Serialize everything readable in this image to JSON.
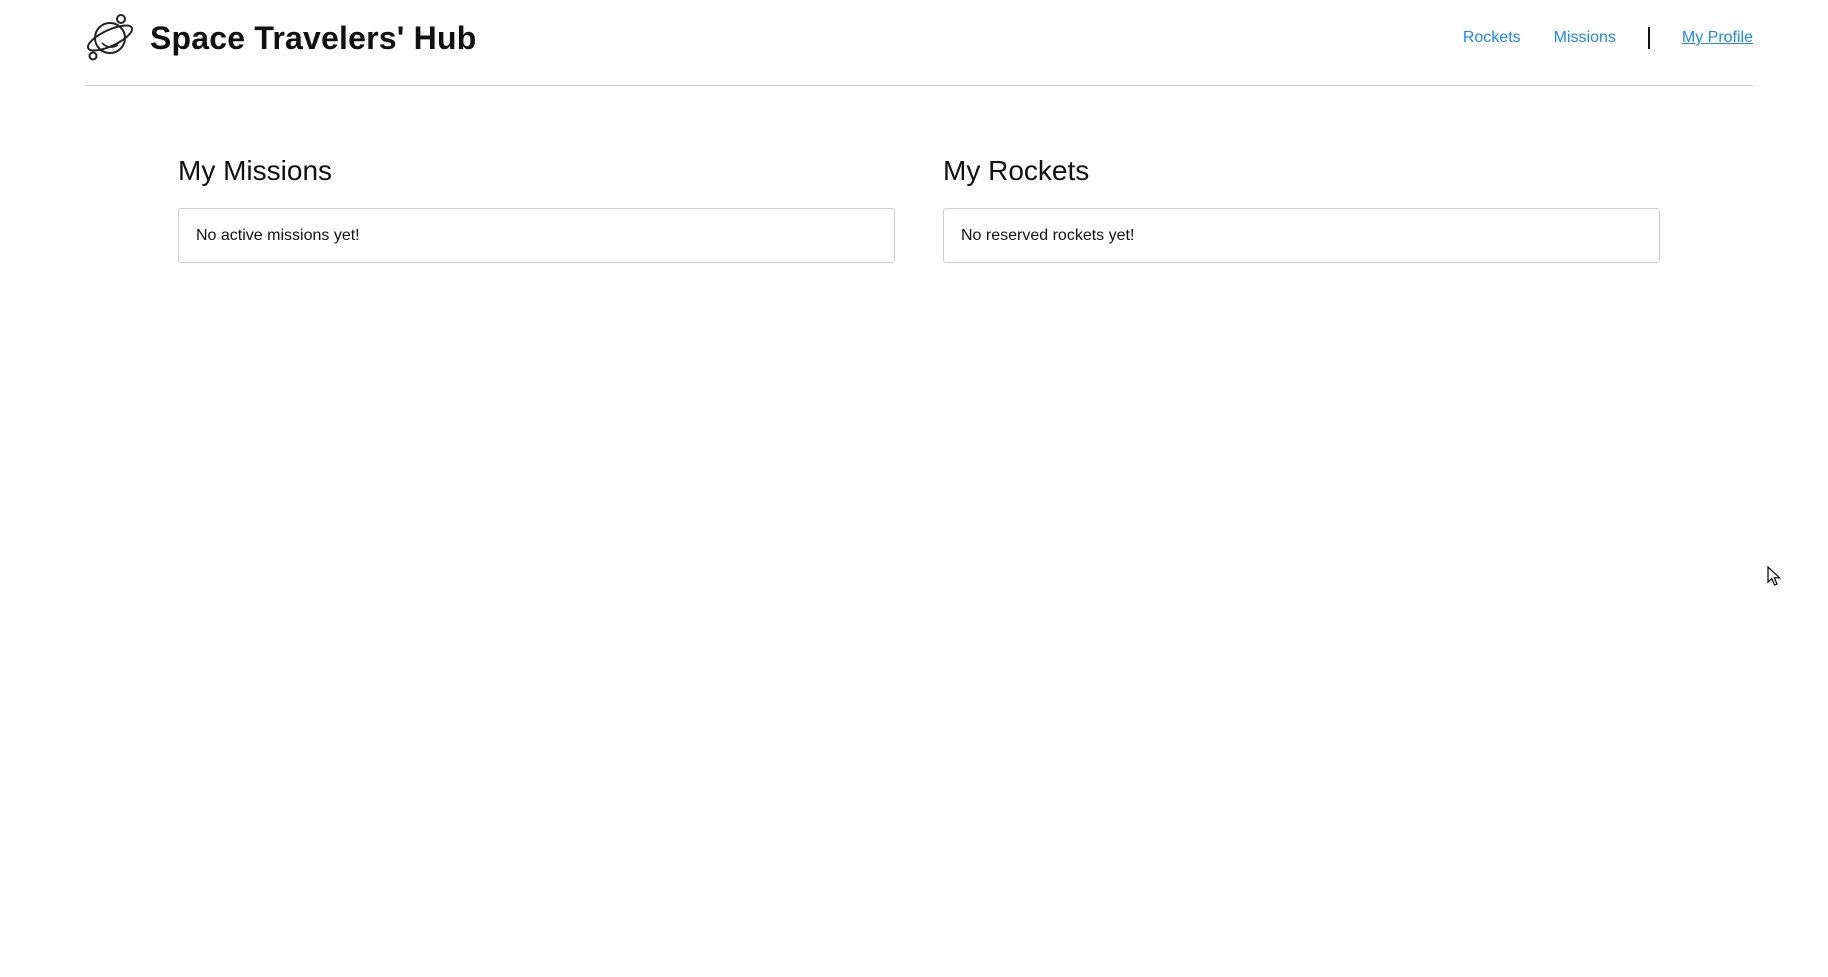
{
  "header": {
    "title": "Space Travelers' Hub",
    "logo_icon": "planet-icon",
    "nav": {
      "rockets": "Rockets",
      "missions": "Missions",
      "profile": "My Profile",
      "active": "My Profile"
    }
  },
  "missions": {
    "title": "My Missions",
    "empty_message": "No active missions yet!"
  },
  "rockets": {
    "title": "My Rockets",
    "empty_message": "No reserved rockets yet!"
  },
  "colors": {
    "link": "#1e88e5",
    "text": "#111111",
    "border": "#cfcfcf"
  }
}
